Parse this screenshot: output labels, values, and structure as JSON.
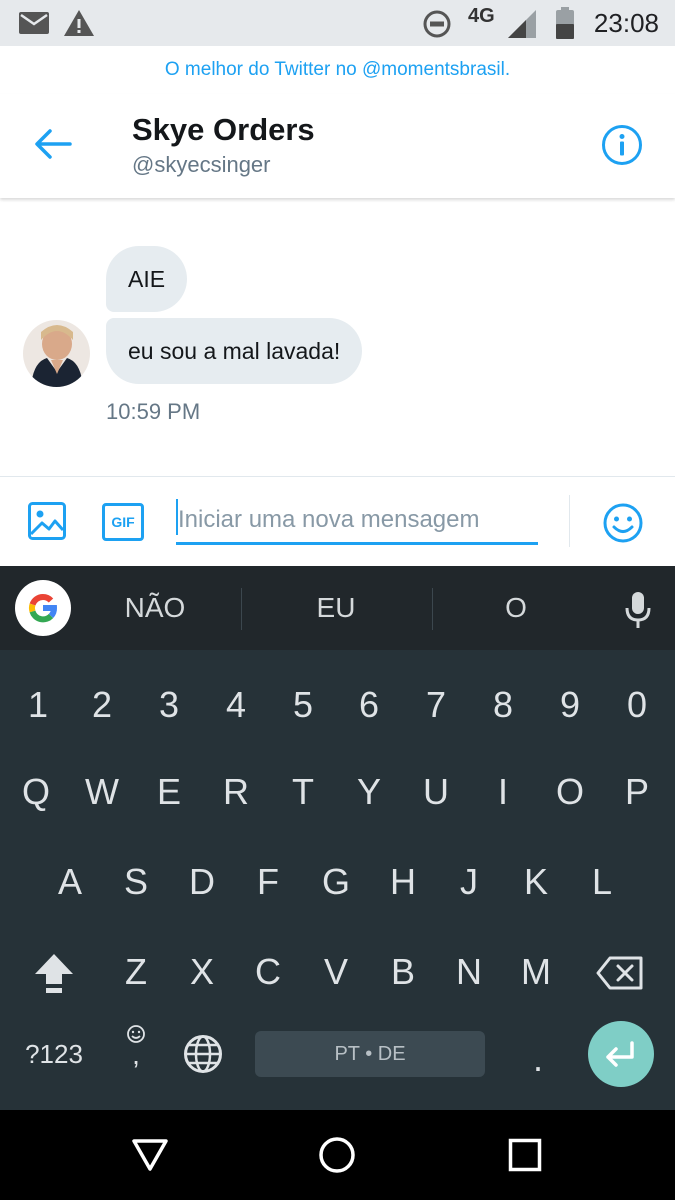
{
  "status_bar": {
    "network": "4G",
    "time": "23:08",
    "icons": [
      "mail-icon",
      "warning-icon",
      "do-not-disturb-icon",
      "signal-icon",
      "battery-icon"
    ]
  },
  "banner": {
    "text": "O melhor do Twitter no @momentsbrasil."
  },
  "header": {
    "name": "Skye Orders",
    "handle": "@skyecsinger",
    "icons": [
      "back-arrow-icon",
      "info-icon"
    ]
  },
  "conversation": {
    "messages": [
      {
        "text": "AIE"
      },
      {
        "text": "eu sou a mal lavada!"
      }
    ],
    "timestamp": "10:59 PM"
  },
  "compose": {
    "placeholder": "Iniciar uma nova mensagem",
    "gif_label": "GIF",
    "icons": [
      "image-icon",
      "gif-icon",
      "emoji-icon"
    ]
  },
  "keyboard": {
    "suggestions": [
      "NÃO",
      "EU",
      "O"
    ],
    "row_numbers": [
      "1",
      "2",
      "3",
      "4",
      "5",
      "6",
      "7",
      "8",
      "9",
      "0"
    ],
    "row_top": [
      "Q",
      "W",
      "E",
      "R",
      "T",
      "Y",
      "U",
      "I",
      "O",
      "P"
    ],
    "row_middle": [
      "A",
      "S",
      "D",
      "F",
      "G",
      "H",
      "J",
      "K",
      "L"
    ],
    "row_bottom": [
      "Z",
      "X",
      "C",
      "V",
      "B",
      "N",
      "M"
    ],
    "symbols_label": "?123",
    "comma_label": ",",
    "period_label": ".",
    "space_label": "PT • DE",
    "colors": {
      "background": "#263238",
      "enter": "#7fcec6"
    }
  },
  "colors": {
    "accent": "#1da1f2",
    "bubble": "#e6ecf0"
  }
}
